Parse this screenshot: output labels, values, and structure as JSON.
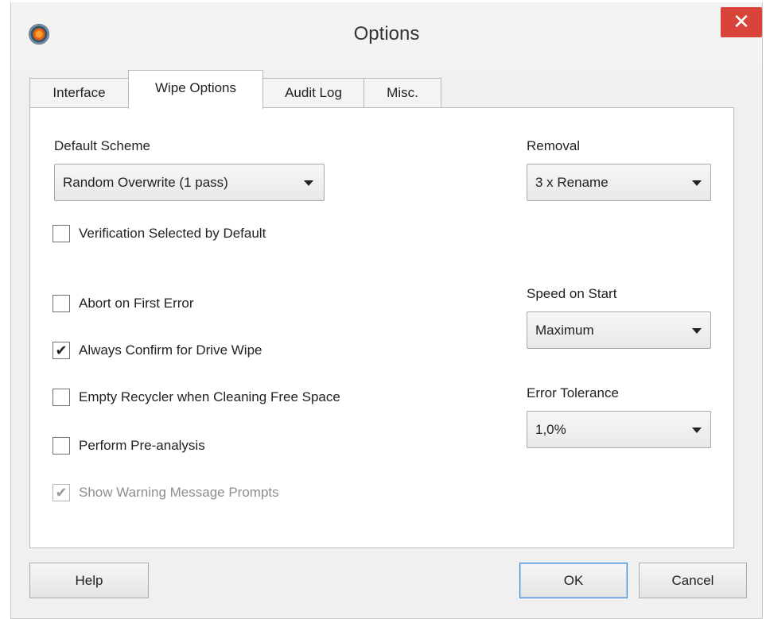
{
  "window": {
    "title": "Options",
    "close_label": "✕"
  },
  "tabs": [
    {
      "label": "Interface",
      "active": false
    },
    {
      "label": "Wipe Options",
      "active": true
    },
    {
      "label": "Audit Log",
      "active": false
    },
    {
      "label": "Misc.",
      "active": false
    }
  ],
  "wipe_options": {
    "default_scheme": {
      "label": "Default Scheme",
      "value": "Random Overwrite (1 pass)"
    },
    "removal": {
      "label": "Removal",
      "value": "3 x Rename"
    },
    "speed_on_start": {
      "label": "Speed on Start",
      "value": "Maximum"
    },
    "error_tolerance": {
      "label": "Error Tolerance",
      "value": "1,0%"
    },
    "checkboxes": [
      {
        "label": "Verification Selected by Default",
        "checked": false,
        "enabled": true
      },
      {
        "label": "Abort on First Error",
        "checked": false,
        "enabled": true
      },
      {
        "label": "Always Confirm for Drive Wipe",
        "checked": true,
        "enabled": true
      },
      {
        "label": "Empty Recycler when Cleaning Free Space",
        "checked": false,
        "enabled": true
      },
      {
        "label": "Perform Pre-analysis",
        "checked": false,
        "enabled": true
      },
      {
        "label": "Show Warning Message Prompts",
        "checked": true,
        "enabled": false
      }
    ]
  },
  "buttons": {
    "help": "Help",
    "ok": "OK",
    "cancel": "Cancel"
  },
  "icons": {
    "check_glyph": "✔",
    "app_icon": "app-logo-icon",
    "close_icon": "close-icon",
    "dropdown_icon": "chevron-down-icon"
  },
  "colors": {
    "close_button": "#d9443a",
    "default_button_border": "#3c8ad8",
    "panel_bg": "#ffffff",
    "dialog_bg": "#f0f0f0"
  }
}
